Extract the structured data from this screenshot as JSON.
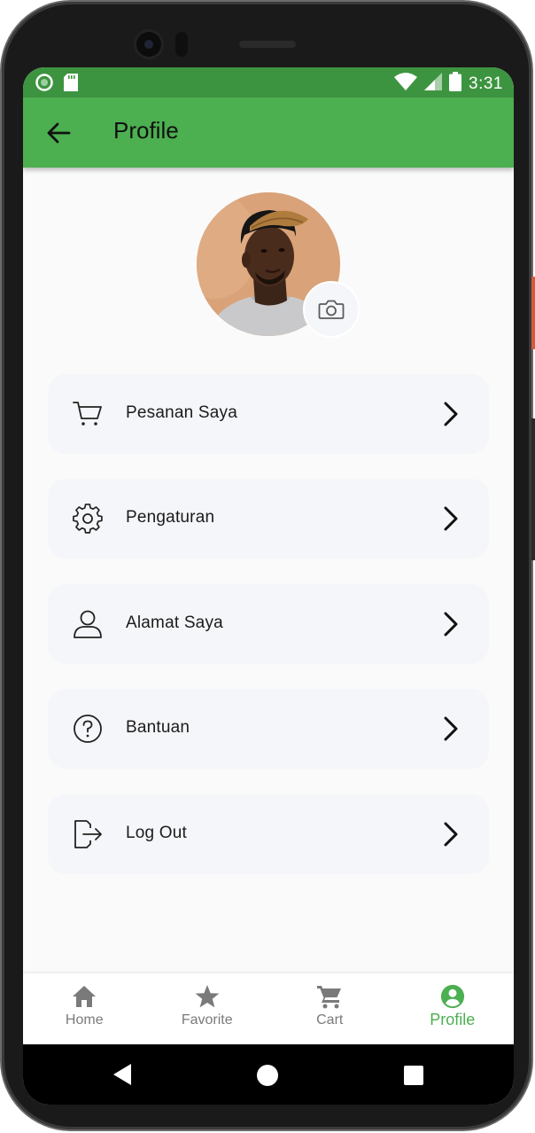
{
  "status_bar": {
    "time": "3:31"
  },
  "app_bar": {
    "title": "Profile"
  },
  "menu": [
    {
      "label": "Pesanan Saya",
      "icon": "cart-icon"
    },
    {
      "label": "Pengaturan",
      "icon": "gear-icon"
    },
    {
      "label": "Alamat Saya",
      "icon": "user-icon"
    },
    {
      "label": "Bantuan",
      "icon": "help-icon"
    },
    {
      "label": "Log Out",
      "icon": "logout-icon"
    }
  ],
  "bottom_nav": {
    "items": [
      {
        "label": "Home",
        "icon": "home-icon",
        "active": false
      },
      {
        "label": "Favorite",
        "icon": "star-icon",
        "active": false
      },
      {
        "label": "Cart",
        "icon": "cart-icon",
        "active": false
      },
      {
        "label": "Profile",
        "icon": "account-circle-icon",
        "active": true
      }
    ]
  },
  "colors": {
    "primary": "#4caf50",
    "status_bar": "#3d9440",
    "active_nav": "#4caf50",
    "inactive_nav": "#7a7a7a",
    "menu_background": "#f5f6f9"
  }
}
